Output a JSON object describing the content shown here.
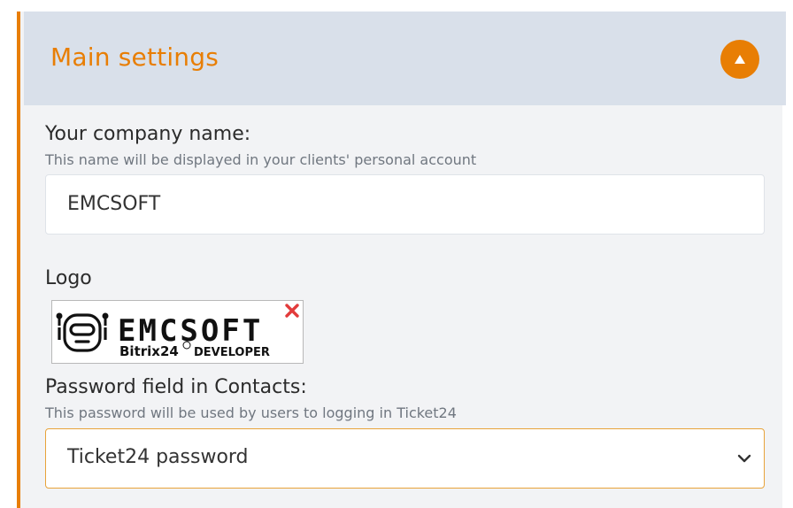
{
  "panel": {
    "title": "Main settings",
    "toggle_icon": "triangle-up-icon",
    "accent_color": "#e87e04"
  },
  "company_name": {
    "label": "Your company name:",
    "hint": "This name will be displayed in your clients' personal account",
    "value": "EMCSOFT"
  },
  "logo": {
    "label": "Logo",
    "brand_text": "EMCSOFT",
    "brand_sub1": "Bitrix24",
    "brand_sub2": "DEVELOPER",
    "remove_icon": "close-icon"
  },
  "password_field": {
    "label": "Password field in Contacts:",
    "hint": "This password will be used by users to logging in Ticket24",
    "selected": "Ticket24 password",
    "chevron_icon": "chevron-down-icon"
  }
}
